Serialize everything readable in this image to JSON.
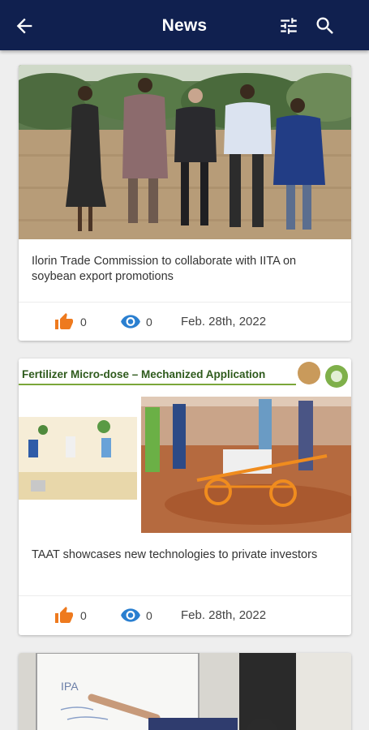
{
  "header": {
    "title": "News",
    "back_icon": "arrow-left-icon",
    "filter_icon": "tune-icon",
    "search_icon": "search-icon",
    "background": "#10204f"
  },
  "articles": [
    {
      "headline": "Ilorin Trade Commission to collaborate with IITA on soybean export promotions",
      "likes": "0",
      "views": "0",
      "date": "Feb. 28th, 2022"
    },
    {
      "headline": "TAAT showcases new technologies to private investors",
      "image_caption": "Fertilizer Micro-dose – Mechanized Application",
      "likes": "0",
      "views": "0",
      "date": "Feb. 28th, 2022"
    },
    {
      "whiteboard_text": "IPA"
    }
  ],
  "colors": {
    "like_icon": "#ee7a1e",
    "view_icon": "#2a7fd0"
  }
}
